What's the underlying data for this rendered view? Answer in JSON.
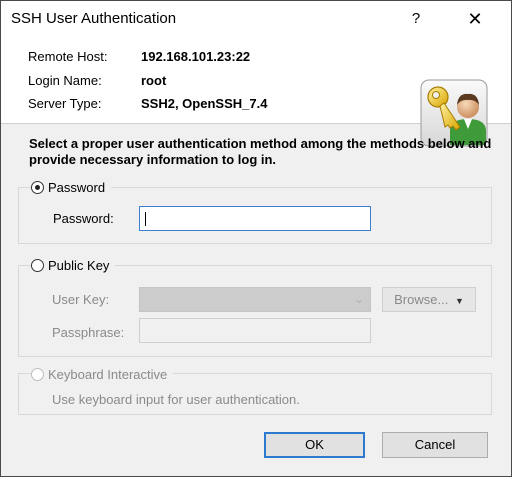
{
  "window": {
    "title": "SSH User Authentication",
    "help_glyph": "?",
    "close_glyph": "✕"
  },
  "info": {
    "remote_host_label": "Remote Host:",
    "remote_host_value": "192.168.101.23:22",
    "login_name_label": "Login Name:",
    "login_name_value": "root",
    "server_type_label": "Server Type:",
    "server_type_value": "SSH2, OpenSSH_7.4"
  },
  "instruction": "Select a proper user authentication method among the methods below and provide necessary information to log in.",
  "password_group": {
    "option_label": "Password",
    "selected": true,
    "field_label": "Password:",
    "field_value": ""
  },
  "public_key_group": {
    "option_label": "Public Key",
    "selected": false,
    "user_key_label": "User Key:",
    "user_key_value": "",
    "browse_label": "Browse...",
    "passphrase_label": "Passphrase:",
    "passphrase_value": ""
  },
  "keyboard_group": {
    "option_label": "Keyboard Interactive",
    "selected": false,
    "description": "Use keyboard input for user authentication."
  },
  "buttons": {
    "ok_label": "OK",
    "cancel_label": "Cancel"
  },
  "icons": {
    "avatar": "user-key-icon",
    "help": "help-icon",
    "close": "close-icon",
    "browse_dropdown": "dropdown-arrow-icon",
    "select_dropdown": "chevron-down-icon"
  },
  "colors": {
    "accent": "#2e7ad1",
    "focus_border": "#3c7fd0",
    "dialog_bg": "#f0f0f0"
  }
}
